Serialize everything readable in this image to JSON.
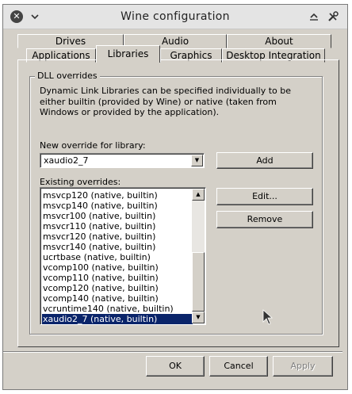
{
  "window": {
    "title": "Wine configuration"
  },
  "tabs_row1": [
    {
      "label": "Drives"
    },
    {
      "label": "Audio"
    },
    {
      "label": "About"
    }
  ],
  "tabs_row2": [
    {
      "label": "Applications"
    },
    {
      "label": "Libraries"
    },
    {
      "label": "Graphics"
    },
    {
      "label": "Desktop Integration"
    }
  ],
  "dll": {
    "group_title": "DLL overrides",
    "description": "Dynamic Link Libraries can be specified individually to be either builtin (provided by Wine) or native (taken from Windows or provided by the application).",
    "new_override_label": "New override for library:",
    "new_override_value": "xaudio2_7",
    "add_label": "Add",
    "existing_label": "Existing overrides:",
    "edit_label": "Edit...",
    "remove_label": "Remove",
    "overrides": [
      "msvcp120 (native, builtin)",
      "msvcp140 (native, builtin)",
      "msvcr100 (native, builtin)",
      "msvcr110 (native, builtin)",
      "msvcr120 (native, builtin)",
      "msvcr140 (native, builtin)",
      "ucrtbase (native, builtin)",
      "vcomp100 (native, builtin)",
      "vcomp110 (native, builtin)",
      "vcomp120 (native, builtin)",
      "vcomp140 (native, builtin)",
      "vcruntime140 (native, builtin)",
      "xaudio2_7 (native, builtin)"
    ],
    "selected_override": "xaudio2_7 (native, builtin)"
  },
  "dialog_buttons": {
    "ok": "OK",
    "cancel": "Cancel",
    "apply": "Apply"
  },
  "icons": {
    "close": "close-icon",
    "menu": "chevron-down-icon",
    "maximize": "maximize-icon",
    "tools": "tools-icon",
    "dropdown": "dropdown-arrow-icon",
    "scroll_up": "scroll-up-icon",
    "scroll_down": "scroll-down-icon",
    "cursor": "mouse-pointer-icon"
  },
  "colors": {
    "dialog_bg": "#d4d0c8",
    "selection": "#0a246a"
  }
}
